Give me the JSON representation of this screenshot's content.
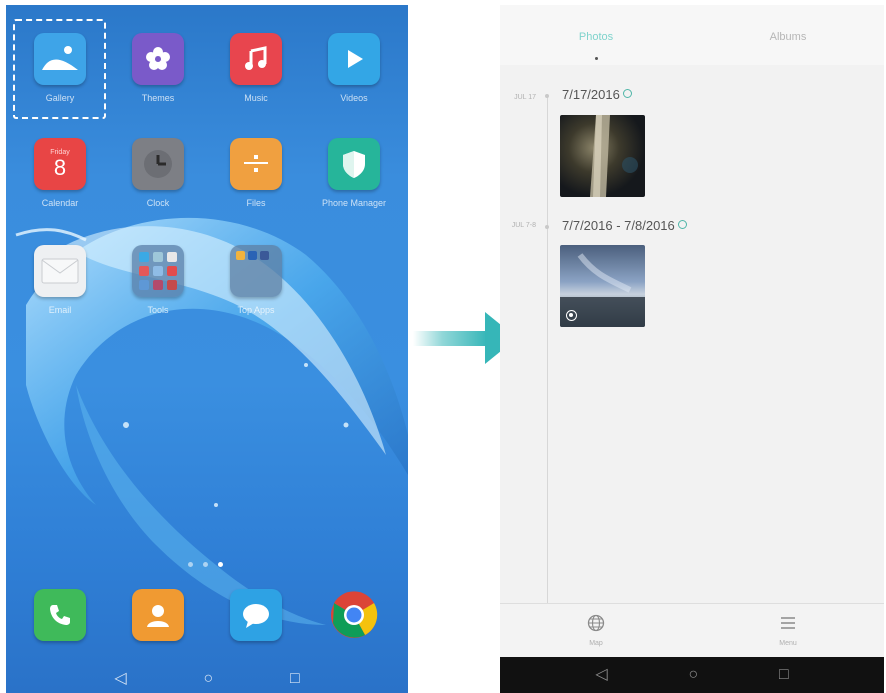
{
  "home": {
    "apps": [
      {
        "name": "Gallery",
        "color": "#3ea4e8"
      },
      {
        "name": "Themes",
        "color": "#7a5ac9"
      },
      {
        "name": "Music",
        "color": "#e8454e"
      },
      {
        "name": "Videos",
        "color": "#33a6e6"
      },
      {
        "name": "Calendar",
        "color": "#e84545",
        "day_label": "Friday",
        "day_number": "8"
      },
      {
        "name": "Clock",
        "color": "#7d7f85"
      },
      {
        "name": "Files",
        "color": "#f0a040"
      },
      {
        "name": "Phone Manager",
        "color": "#26b59a"
      },
      {
        "name": "Email",
        "color": "#eef0f2"
      },
      {
        "name": "Tools",
        "color": "#5a7fa8"
      },
      {
        "name": "Top Apps",
        "color": "#5e7fa3"
      }
    ],
    "dock": [
      {
        "name": "Phone",
        "color": "#3fba5a",
        "icon": "phone-icon"
      },
      {
        "name": "Contacts",
        "color": "#f09a32",
        "icon": "contacts-icon"
      },
      {
        "name": "Messaging",
        "color": "#2ea2e4",
        "icon": "chat-bubble-icon"
      },
      {
        "name": "Chrome",
        "color": "#ffffff",
        "icon": "chrome-icon"
      }
    ],
    "nav": {
      "back": "◁",
      "home": "○",
      "recents": "□"
    }
  },
  "gallery": {
    "tabs": [
      {
        "label": "Photos",
        "active": true
      },
      {
        "label": "Albums",
        "active": false
      }
    ],
    "groups": [
      {
        "side": "JUL 17",
        "date": "7/17/2016"
      },
      {
        "side": "JUL 7-8",
        "date": "7/7/2016 - 7/8/2016"
      }
    ],
    "bottom": [
      {
        "label": "Map",
        "icon": "globe-icon"
      },
      {
        "label": "Menu",
        "icon": "menu-icon"
      }
    ],
    "nav": {
      "back": "◁",
      "home": "○",
      "recents": "□"
    }
  },
  "arrow_color": "#36b6b8"
}
